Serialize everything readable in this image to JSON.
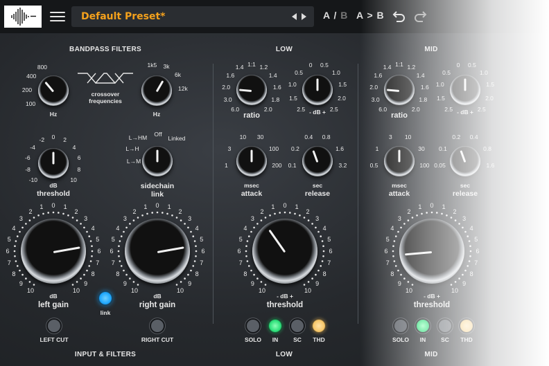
{
  "topbar": {
    "preset_name": "Default Preset*",
    "ab_label_a": "A / ",
    "ab_label_b": "B",
    "a_to_b": "A > B"
  },
  "sections": {
    "bandpass": "BANDPASS FILTERS",
    "low": "LOW",
    "mid": "MID",
    "input_filters": "INPUT & FILTERS",
    "low_footer": "LOW",
    "mid_footer": "MID"
  },
  "bandpass": {
    "low_freq": {
      "ticks": [
        "100",
        "200",
        "400",
        "800"
      ],
      "unit": "Hz"
    },
    "high_freq": {
      "ticks": [
        "1k5",
        "3k",
        "6k",
        "12k"
      ],
      "unit": "Hz"
    },
    "crossover_label": "crossover\nfrequencies",
    "threshold": {
      "ticks": [
        "-10",
        "-8",
        "-6",
        "-4",
        "-2",
        "0",
        "2",
        "4",
        "6",
        "8",
        "10"
      ],
      "unit": "dB",
      "label": "threshold"
    },
    "sidechain": {
      "options": [
        "L→M",
        "L→H",
        "L→HM",
        "Off",
        "Linked"
      ],
      "label": "sidechain\nlink"
    }
  },
  "band": {
    "ratio": {
      "ticks": [
        "6.0",
        "3.0",
        "2.0",
        "1.6",
        "1.4",
        "1:1",
        "1.2",
        "1.4",
        "1.6",
        "1.8",
        "2.0"
      ],
      "label": "ratio"
    },
    "gain": {
      "ticks": [
        "2.5",
        "1.5",
        "1.0",
        "0.5",
        "0",
        "0.5",
        "1.0",
        "1.5",
        "2.0",
        "2.5"
      ],
      "unit": "- dB +"
    },
    "attack": {
      "ticks": [
        "1",
        "3",
        "10",
        "30",
        "100",
        "200"
      ],
      "unit": "msec",
      "label": "attack"
    },
    "release": {
      "ticks": [
        "0.1",
        "0.2",
        "0.4",
        "0.8",
        "1.6",
        "3.2"
      ],
      "unit": "sec",
      "label": "release"
    },
    "threshold": {
      "unit": "- dB +",
      "label": "threshold"
    },
    "buttons": [
      "SOLO",
      "IN",
      "SC",
      "THD"
    ]
  },
  "mid_band": {
    "ratio": {
      "ticks": [
        "6.0",
        "3.0",
        "2.0",
        "1.6",
        "1.4",
        "1:1",
        "1.2",
        "1.4",
        "1.6",
        "1.8",
        "2.0"
      ],
      "label": "ratio"
    },
    "gain": {
      "ticks": [
        "2.5",
        "1.5",
        "1.0",
        "0.5",
        "0",
        "0.5",
        "1.0",
        "1.5",
        "2.0",
        "2.5"
      ],
      "unit": "- dB +"
    },
    "attack": {
      "ticks": [
        "0.5",
        "1",
        "3",
        "10",
        "30",
        "100"
      ],
      "unit": "msec",
      "label": "attack"
    },
    "release": {
      "ticks": [
        "0.05",
        "0.1",
        "0.2",
        "0.4",
        "0.8",
        "1.6"
      ],
      "unit": "sec",
      "label": "release"
    },
    "threshold": {
      "unit": "- dB +",
      "label": "threshold"
    },
    "buttons": [
      "SOLO",
      "IN",
      "SC",
      "THD"
    ]
  },
  "input": {
    "left_gain": {
      "label": "left gain",
      "unit": "dB"
    },
    "right_gain": {
      "label": "right gain",
      "unit": "dB"
    },
    "link": "link",
    "left_cut": "LEFT CUT",
    "right_cut": "RIGHT CUT"
  },
  "gain_scale": [
    "10",
    "9",
    "8",
    "7",
    "6",
    "5",
    "4",
    "3",
    "2",
    "1",
    "0",
    "1",
    "2",
    "3",
    "4",
    "5",
    "6",
    "7",
    "8",
    "9",
    "10"
  ],
  "colors": {
    "accent": "#f4a11c",
    "link_led": "#1fa8ff",
    "in_led": "#2ee07a",
    "thd_led": "#f6c76b",
    "off_btn": "#5a5f66"
  }
}
